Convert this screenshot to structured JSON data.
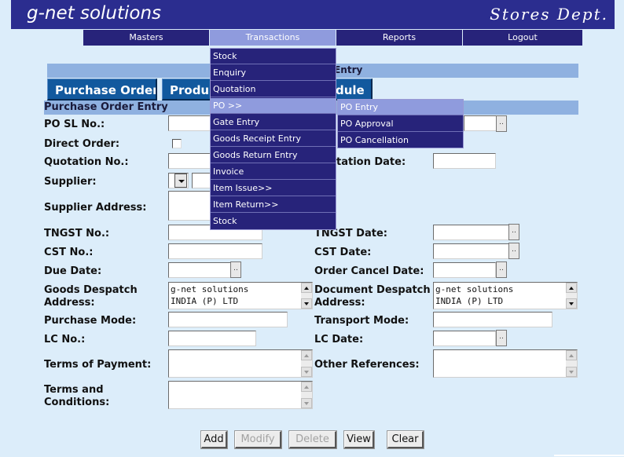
{
  "brand": "g-net solutions",
  "department": "Stores Dept.",
  "menu": {
    "items": [
      {
        "label": "Masters"
      },
      {
        "label": "Transactions"
      },
      {
        "label": "Reports"
      },
      {
        "label": "Logout"
      }
    ],
    "active": "Transactions"
  },
  "page_title_fragment": "r Entry",
  "tabs": [
    {
      "label": "Purchase Order"
    },
    {
      "label": "Produ"
    },
    {
      "label": "dule"
    }
  ],
  "section_title": "Purchase Order Entry",
  "transactions_dropdown": [
    {
      "label": "Stock"
    },
    {
      "label": "Enquiry"
    },
    {
      "label": "Quotation"
    },
    {
      "label": "PO >>"
    },
    {
      "label": "Gate Entry"
    },
    {
      "label": "Goods Receipt Entry"
    },
    {
      "label": "Goods Return Entry"
    },
    {
      "label": "Invoice"
    },
    {
      "label": "Item Issue>>"
    },
    {
      "label": "Item Return>>"
    },
    {
      "label": "Stock"
    }
  ],
  "po_submenu": [
    {
      "label": "PO Entry"
    },
    {
      "label": "PO Approval"
    },
    {
      "label": "PO Cancellation"
    }
  ],
  "form": {
    "po_sl_no": {
      "label": "PO SL No.:",
      "value": ""
    },
    "direct_order": {
      "label": "Direct Order:",
      "checked": false
    },
    "quotation_no": {
      "label": "Quotation No.:",
      "value": ""
    },
    "quotation_date": {
      "label": "tation Date:",
      "value": ""
    },
    "supplier": {
      "label": "Supplier:",
      "value": ""
    },
    "supplier_address": {
      "label": "Supplier Address:",
      "value": ""
    },
    "tngst_no": {
      "label": "TNGST No.:",
      "value": ""
    },
    "tngst_date": {
      "label": "TNGST Date:",
      "value": ""
    },
    "cst_no": {
      "label": "CST No.:",
      "value": ""
    },
    "cst_date": {
      "label": "CST Date:",
      "value": ""
    },
    "due_date": {
      "label": "Due Date:",
      "value": ""
    },
    "order_cancel_date": {
      "label": "Order Cancel Date:",
      "value": ""
    },
    "goods_despatch_address": {
      "label_line1": "Goods Despatch",
      "label_line2": "Address:",
      "value_line1": "g-net solutions",
      "value_line2": "INDIA (P) LTD"
    },
    "document_despatch_address": {
      "label_line1": "Document Despatch",
      "label_line2": "Address:",
      "value_line1": "g-net solutions",
      "value_line2": "INDIA (P) LTD"
    },
    "purchase_mode": {
      "label": "Purchase Mode:",
      "value": ""
    },
    "transport_mode": {
      "label": "Transport Mode:",
      "value": ""
    },
    "lc_no": {
      "label": "LC No.:",
      "value": ""
    },
    "lc_date": {
      "label": "LC Date:",
      "value": ""
    },
    "terms_of_payment": {
      "label": "Terms of Payment:",
      "value": ""
    },
    "other_references": {
      "label": "Other References:",
      "value": ""
    },
    "terms_and_conditions": {
      "label_line1": "Terms and",
      "label_line2": "Conditions:",
      "value": ""
    },
    "calendar_button_label": ".."
  },
  "actions": {
    "add": {
      "label": "Add",
      "enabled": true
    },
    "modify": {
      "label": "Modify",
      "enabled": false
    },
    "delete": {
      "label": "Delete",
      "enabled": false
    },
    "view": {
      "label": "View",
      "enabled": true
    },
    "clear": {
      "label": "Clear",
      "enabled": true
    }
  },
  "colors": {
    "banner": "#2b2d8f",
    "menu_bar": "#27237a",
    "menu_active": "#8f9bdd",
    "background": "#dcedfa",
    "section_bar": "#8fb1e0",
    "tab": "#12599e"
  }
}
